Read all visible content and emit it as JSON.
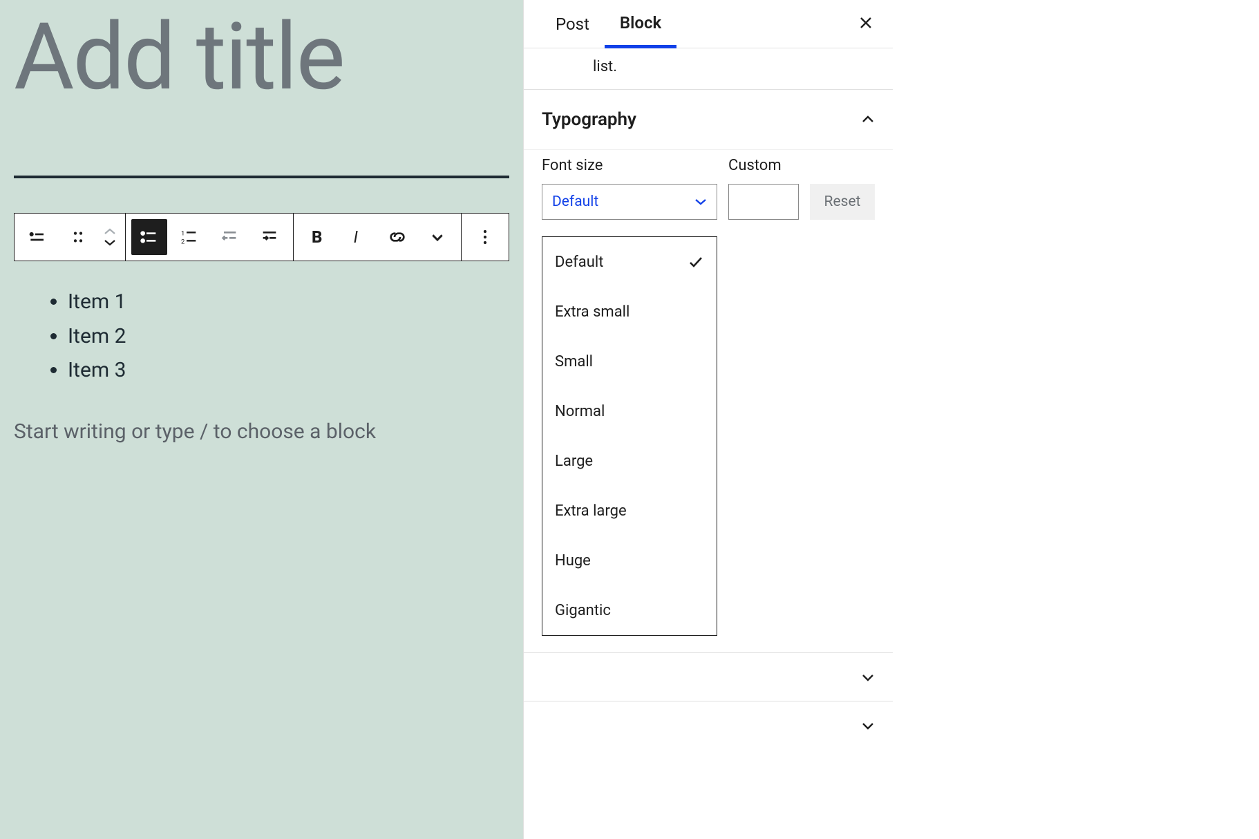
{
  "editor": {
    "title_placeholder": "Add title",
    "list_items": [
      "Item 1",
      "Item 2",
      "Item 3"
    ],
    "helper_text": "Start writing or type / to choose a block"
  },
  "toolbar": {
    "icons": {
      "list_block": "list-block-icon",
      "drag": "drag-handle-icon",
      "bulleted": "bulleted-list-icon",
      "numbered": "numbered-list-icon",
      "outdent": "outdent-icon",
      "indent": "indent-icon",
      "bold": "bold-icon",
      "italic": "italic-icon",
      "link": "link-icon",
      "more_inline": "chevron-down-icon",
      "more": "more-menu-icon"
    }
  },
  "sidebar": {
    "tabs": {
      "post": "Post",
      "block": "Block"
    },
    "description_fragment": "list.",
    "typography": {
      "heading": "Typography",
      "font_size_label": "Font size",
      "custom_label": "Custom",
      "reset_label": "Reset",
      "selected": "Default",
      "options": [
        "Default",
        "Extra small",
        "Small",
        "Normal",
        "Large",
        "Extra large",
        "Huge",
        "Gigantic"
      ]
    }
  }
}
